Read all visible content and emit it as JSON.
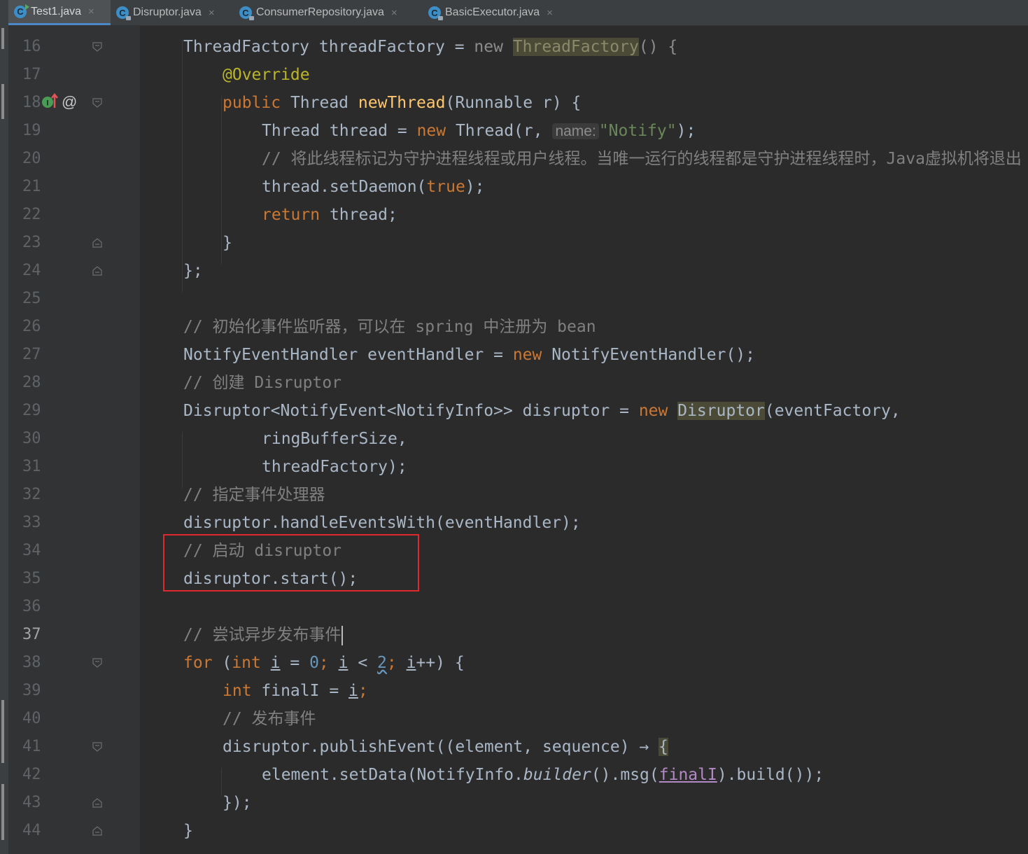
{
  "tabs": [
    {
      "label": "Test1.java",
      "icon": "run-class-icon",
      "active": true
    },
    {
      "label": "Disruptor.java",
      "icon": "class-locked-icon",
      "active": false
    },
    {
      "label": "ConsumerRepository.java",
      "icon": "class-locked-icon",
      "active": false
    },
    {
      "label": "BasicExecutor.java",
      "icon": "class-locked-icon",
      "active": false
    }
  ],
  "close_glyph": "×",
  "line_numbers": [
    "16",
    "17",
    "18",
    "19",
    "20",
    "21",
    "22",
    "23",
    "24",
    "25",
    "26",
    "27",
    "28",
    "29",
    "30",
    "31",
    "32",
    "33",
    "34",
    "35",
    "36",
    "37",
    "38",
    "39",
    "40",
    "41",
    "42",
    "43",
    "44"
  ],
  "current_line": "37",
  "gutter_icons": {
    "implements_marker": "I",
    "annotation_marker": "@"
  },
  "code": {
    "l16": {
      "a": "ThreadFactory threadFactory = ",
      "kw": "new",
      "sp": " ",
      "hl": "ThreadFactory",
      "b": "() {"
    },
    "l17": {
      "ann": "@Override"
    },
    "l18": {
      "kw": "public",
      "a": " Thread ",
      "fn": "newThread",
      "b": "(Runnable r) {"
    },
    "l19": {
      "a": "Thread thread = ",
      "kw": "new",
      "b": " Thread(r, ",
      "hint": "name:",
      "str": "\"Notify\"",
      "c": ");"
    },
    "l20": {
      "cm": "// 将此线程标记为守护进程线程或用户线程。当唯一运行的线程都是守护进程线程时，Java虚拟机将退出"
    },
    "l21": {
      "a": "thread.setDaemon(",
      "kw": "true",
      "b": ");"
    },
    "l22": {
      "kw": "return",
      "a": " thread;"
    },
    "l23": {
      "a": "}"
    },
    "l24": {
      "a": "};"
    },
    "l26": {
      "cm": "// 初始化事件监听器，可以在 spring 中注册为 bean"
    },
    "l27": {
      "a": "NotifyEventHandler eventHandler = ",
      "kw": "new",
      "b": " NotifyEventHandler();"
    },
    "l28": {
      "cm": "// 创建 Disruptor"
    },
    "l29": {
      "a": "Disruptor<NotifyEvent<NotifyInfo>> disruptor = ",
      "kw": "new",
      "sp": " ",
      "hl": "Disruptor",
      "b": "(eventFactory,"
    },
    "l30": {
      "a": "ringBufferSize,"
    },
    "l31": {
      "a": "threadFactory);"
    },
    "l32": {
      "cm": "// 指定事件处理器"
    },
    "l33": {
      "a": "disruptor.handleEventsWith(eventHandler);"
    },
    "l34": {
      "cm": "// 启动 disruptor"
    },
    "l35": {
      "a": "disruptor.start();"
    },
    "l37": {
      "cm": "// 尝试异步发布事件"
    },
    "l38": {
      "kw": "for",
      "a": " (",
      "kw2": "int",
      "sp": " ",
      "i1": "i",
      "b": " = ",
      "n0": "0",
      "c": "; ",
      "i2": "i",
      "d": " < ",
      "n2": "2",
      "e": "; ",
      "i3": "i",
      "f": "++) {"
    },
    "l39": {
      "kw": "int",
      "a": " finalI = ",
      "i": "i",
      "b": ";"
    },
    "l40": {
      "cm": "// 发布事件"
    },
    "l41": {
      "a": "disruptor.publishEvent((element, sequence) ",
      "arrow": "→",
      "sp": " ",
      "brace": "{"
    },
    "l42": {
      "a": "element.setData(NotifyInfo.",
      "it": "builder",
      "b": "().msg(",
      "v": "finalI",
      "c": ").build());"
    },
    "l43": {
      "a": "});"
    },
    "l44": {
      "a": "}"
    }
  },
  "colors": {
    "keyword": "#cc7832",
    "string": "#6a8759",
    "number": "#6897bb",
    "comment": "#808080",
    "annotation": "#bbb529",
    "method_decl": "#ffc66d",
    "highlight_box": "#e0282f"
  }
}
